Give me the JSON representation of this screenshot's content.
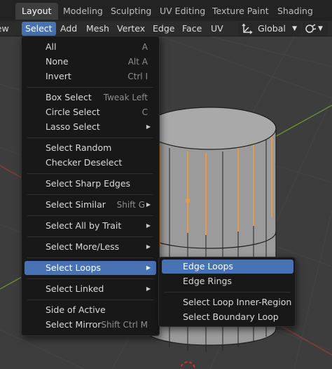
{
  "workspace_tabs": [
    "Layout",
    "Modeling",
    "Sculpting",
    "UV Editing",
    "Texture Paint",
    "Shading"
  ],
  "header_menus": [
    "View",
    "Select",
    "Add",
    "Mesh",
    "Vertex",
    "Edge",
    "Face",
    "UV"
  ],
  "orientation": {
    "icon": "transform-orientation-icon",
    "value": "Global"
  },
  "snap": {
    "icon": "snap-magnet-icon"
  },
  "select_menu": {
    "items": [
      {
        "label": "All",
        "shortcut": "A"
      },
      {
        "label": "None",
        "shortcut": "Alt A"
      },
      {
        "label": "Invert",
        "shortcut": "Ctrl I"
      },
      {
        "label": "Box Select",
        "shortcut": "Tweak Left"
      },
      {
        "label": "Circle Select",
        "shortcut": "C"
      },
      {
        "label": "Lasso Select",
        "shortcut": ""
      },
      {
        "label": "Select Random",
        "shortcut": ""
      },
      {
        "label": "Checker Deselect",
        "shortcut": ""
      },
      {
        "label": "Select Sharp Edges",
        "shortcut": ""
      },
      {
        "label": "Select Similar",
        "shortcut": "Shift G"
      },
      {
        "label": "Select All by Trait",
        "shortcut": ""
      },
      {
        "label": "Select More/Less",
        "shortcut": ""
      },
      {
        "label": "Select Loops",
        "shortcut": ""
      },
      {
        "label": "Select Linked",
        "shortcut": ""
      },
      {
        "label": "Side of Active",
        "shortcut": ""
      },
      {
        "label": "Select Mirror",
        "shortcut": "Shift Ctrl M"
      }
    ]
  },
  "loops_submenu": {
    "items": [
      {
        "label": "Edge Loops"
      },
      {
        "label": "Edge Rings"
      },
      {
        "label": "Select Loop Inner-Region"
      },
      {
        "label": "Select Boundary Loop"
      }
    ]
  },
  "colors": {
    "accent": "#4772b3",
    "menu_background": "#181818",
    "viewport_background": "#3d3d3d",
    "selected_edge": "#ff9a2e"
  }
}
